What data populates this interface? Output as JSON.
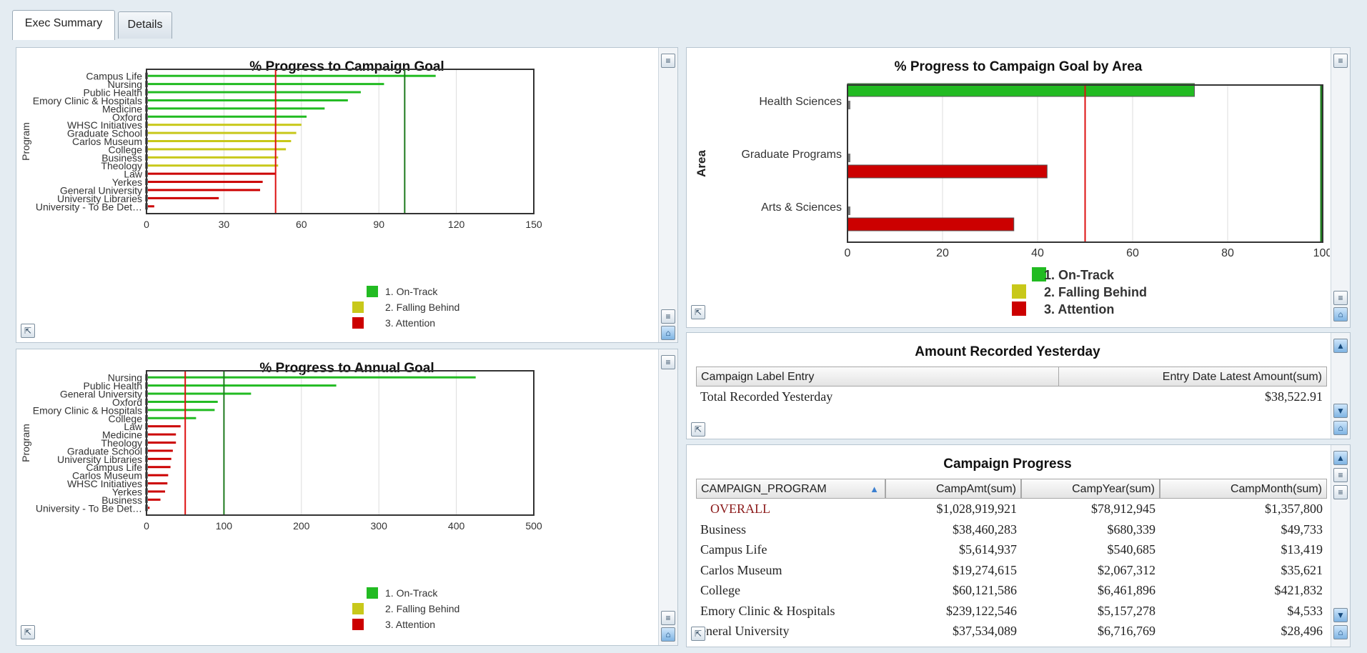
{
  "tabs": [
    {
      "label": "Exec Summary",
      "active": true
    },
    {
      "label": "Details",
      "active": false
    }
  ],
  "legend": [
    "1. On-Track",
    "2. Falling Behind",
    "3. Attention"
  ],
  "colors": {
    "on_track": "#22bb22",
    "falling_behind": "#c8c81a",
    "attention": "#cc0000",
    "target_line": "#1e7a1e",
    "threshold_line": "#dd1111"
  },
  "icons": {
    "menu": "menu-lines-icon",
    "export": "export-icon",
    "home": "home-icon"
  },
  "charts": {
    "campaign_goal": {
      "chart_data": {
        "type": "bar",
        "orientation": "horizontal",
        "title": "% Progress to Campaign Goal",
        "ylabel": "Program",
        "xlim": [
          0,
          150
        ],
        "xticks": [
          0,
          30,
          60,
          90,
          120,
          150
        ],
        "reference_lines": [
          50,
          100
        ],
        "categories": [
          "Campus Life",
          "Nursing",
          "Public Health",
          "Emory Clinic & Hospitals",
          "Medicine",
          "Oxford",
          "WHSC Initiatives",
          "Graduate School",
          "Carlos Museum",
          "College",
          "Business",
          "Theology",
          "Law",
          "Yerkes",
          "General University",
          "University Libraries",
          "University - To Be Det…"
        ],
        "values": [
          112,
          92,
          83,
          78,
          69,
          62,
          60,
          58,
          56,
          54,
          51,
          51,
          50,
          45,
          44,
          28,
          3
        ],
        "status": [
          1,
          1,
          1,
          1,
          1,
          1,
          2,
          2,
          2,
          2,
          2,
          2,
          3,
          3,
          3,
          3,
          3
        ]
      }
    },
    "annual_goal": {
      "chart_data": {
        "type": "bar",
        "orientation": "horizontal",
        "title": "% Progress to Annual Goal",
        "ylabel": "Program",
        "xlim": [
          0,
          500
        ],
        "xticks": [
          0,
          100,
          200,
          300,
          400,
          500
        ],
        "reference_lines": [
          50,
          100
        ],
        "categories": [
          "Nursing",
          "Public Health",
          "General University",
          "Oxford",
          "Emory Clinic & Hospitals",
          "College",
          "Law",
          "Medicine",
          "Theology",
          "Graduate School",
          "University Libraries",
          "Campus Life",
          "Carlos Museum",
          "WHSC Initiatives",
          "Yerkes",
          "Business",
          "University - To Be Det…"
        ],
        "values": [
          425,
          245,
          135,
          92,
          88,
          64,
          44,
          38,
          38,
          34,
          32,
          31,
          28,
          27,
          24,
          18,
          4
        ],
        "status": [
          1,
          1,
          1,
          1,
          1,
          1,
          3,
          3,
          3,
          3,
          3,
          3,
          3,
          3,
          3,
          3,
          3
        ]
      }
    },
    "by_area": {
      "chart_data": {
        "type": "bar",
        "orientation": "horizontal",
        "title": "% Progress to Campaign Goal by Area",
        "ylabel": "Area",
        "xlim": [
          0,
          100
        ],
        "xticks": [
          0,
          20,
          40,
          60,
          80,
          100
        ],
        "reference_lines": [
          50
        ],
        "categories": [
          "Health Sciences",
          "Graduate Programs",
          "Arts & Sciences"
        ],
        "values": [
          73,
          42,
          35
        ],
        "status": [
          1,
          3,
          3
        ]
      }
    }
  },
  "yesterday": {
    "title": "Amount Recorded Yesterday",
    "headers": [
      "Campaign Label Entry",
      "Entry Date Latest Amount(sum)"
    ],
    "rows": [
      [
        "Total Recorded Yesterday",
        "$38,522.91"
      ]
    ]
  },
  "progress": {
    "title": "Campaign Progress",
    "headers": [
      "CAMPAIGN_PROGRAM",
      "CampAmt(sum)",
      "CampYear(sum)",
      "CampMonth(sum)"
    ],
    "sort_icon": "sort-up-icon",
    "rows": [
      [
        "OVERALL",
        "$1,028,919,921",
        "$78,912,945",
        "$1,357,800"
      ],
      [
        "Business",
        "$38,460,283",
        "$680,339",
        "$49,733"
      ],
      [
        "Campus Life",
        "$5,614,937",
        "$540,685",
        "$13,419"
      ],
      [
        "Carlos Museum",
        "$19,274,615",
        "$2,067,312",
        "$35,621"
      ],
      [
        "College",
        "$60,121,586",
        "$6,461,896",
        "$421,832"
      ],
      [
        "Emory Clinic & Hospitals",
        "$239,122,546",
        "$5,157,278",
        "$4,533"
      ],
      [
        "eneral University",
        "$37,534,089",
        "$6,716,769",
        "$28,496"
      ]
    ]
  }
}
